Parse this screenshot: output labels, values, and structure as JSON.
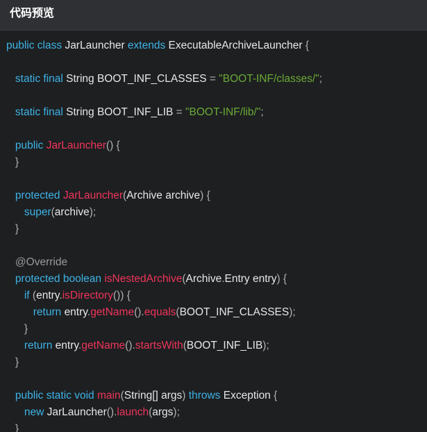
{
  "header": {
    "title": "代码预览"
  },
  "colors": {
    "keyword": "#3fb3e6",
    "string": "#6bab36",
    "function": "#f0355b",
    "plain": "#e8e8e8",
    "background": "#1d1f21",
    "header_bg": "#2f3033"
  },
  "code": {
    "lines": [
      [
        {
          "t": "public class ",
          "c": "kw"
        },
        {
          "t": "JarLauncher ",
          "c": "id"
        },
        {
          "t": "extends ",
          "c": "kw"
        },
        {
          "t": "ExecutableArchiveLauncher ",
          "c": "id"
        },
        {
          "t": "{",
          "c": "op"
        }
      ],
      [],
      [
        {
          "t": "   static final ",
          "c": "kw"
        },
        {
          "t": "String BOOT_INF_CLASSES ",
          "c": "id"
        },
        {
          "t": "= ",
          "c": "op"
        },
        {
          "t": "\"BOOT-INF/classes/\"",
          "c": "str"
        },
        {
          "t": ";",
          "c": "op"
        }
      ],
      [],
      [
        {
          "t": "   static final ",
          "c": "kw"
        },
        {
          "t": "String BOOT_INF_LIB ",
          "c": "id"
        },
        {
          "t": "= ",
          "c": "op"
        },
        {
          "t": "\"BOOT-INF/lib/\"",
          "c": "str"
        },
        {
          "t": ";",
          "c": "op"
        }
      ],
      [],
      [
        {
          "t": "   public ",
          "c": "kw"
        },
        {
          "t": "JarLauncher",
          "c": "fn"
        },
        {
          "t": "() {",
          "c": "op"
        }
      ],
      [
        {
          "t": "   }",
          "c": "op"
        }
      ],
      [],
      [
        {
          "t": "   protected ",
          "c": "kw"
        },
        {
          "t": "JarLauncher",
          "c": "fn"
        },
        {
          "t": "(",
          "c": "op"
        },
        {
          "t": "Archive archive",
          "c": "id"
        },
        {
          "t": ") {",
          "c": "op"
        }
      ],
      [
        {
          "t": "      super",
          "c": "kw"
        },
        {
          "t": "(",
          "c": "op"
        },
        {
          "t": "archive",
          "c": "id"
        },
        {
          "t": ");",
          "c": "op"
        }
      ],
      [
        {
          "t": "   }",
          "c": "op"
        }
      ],
      [],
      [
        {
          "t": "   @Override",
          "c": "ann"
        }
      ],
      [
        {
          "t": "   protected boolean ",
          "c": "kw"
        },
        {
          "t": "isNestedArchive",
          "c": "fn"
        },
        {
          "t": "(",
          "c": "op"
        },
        {
          "t": "Archive",
          "c": "id"
        },
        {
          "t": ".",
          "c": "op"
        },
        {
          "t": "Entry entry",
          "c": "id"
        },
        {
          "t": ") {",
          "c": "op"
        }
      ],
      [
        {
          "t": "      if ",
          "c": "kw"
        },
        {
          "t": "(",
          "c": "op"
        },
        {
          "t": "entry",
          "c": "id"
        },
        {
          "t": ".",
          "c": "op"
        },
        {
          "t": "isDirectory",
          "c": "fn"
        },
        {
          "t": "()) {",
          "c": "op"
        }
      ],
      [
        {
          "t": "         return ",
          "c": "kw"
        },
        {
          "t": "entry",
          "c": "id"
        },
        {
          "t": ".",
          "c": "op"
        },
        {
          "t": "getName",
          "c": "fn"
        },
        {
          "t": "().",
          "c": "op"
        },
        {
          "t": "equals",
          "c": "fn"
        },
        {
          "t": "(",
          "c": "op"
        },
        {
          "t": "BOOT_INF_CLASSES",
          "c": "id"
        },
        {
          "t": ");",
          "c": "op"
        }
      ],
      [
        {
          "t": "      }",
          "c": "op"
        }
      ],
      [
        {
          "t": "      return ",
          "c": "kw"
        },
        {
          "t": "entry",
          "c": "id"
        },
        {
          "t": ".",
          "c": "op"
        },
        {
          "t": "getName",
          "c": "fn"
        },
        {
          "t": "().",
          "c": "op"
        },
        {
          "t": "startsWith",
          "c": "fn"
        },
        {
          "t": "(",
          "c": "op"
        },
        {
          "t": "BOOT_INF_LIB",
          "c": "id"
        },
        {
          "t": ");",
          "c": "op"
        }
      ],
      [
        {
          "t": "   }",
          "c": "op"
        }
      ],
      [],
      [
        {
          "t": "   public static void ",
          "c": "kw"
        },
        {
          "t": "main",
          "c": "fn"
        },
        {
          "t": "(",
          "c": "op"
        },
        {
          "t": "String[] args",
          "c": "id"
        },
        {
          "t": ") ",
          "c": "op"
        },
        {
          "t": "throws ",
          "c": "kw"
        },
        {
          "t": "Exception ",
          "c": "id"
        },
        {
          "t": "{",
          "c": "op"
        }
      ],
      [
        {
          "t": "      new ",
          "c": "kw"
        },
        {
          "t": "JarLauncher",
          "c": "id"
        },
        {
          "t": "().",
          "c": "op"
        },
        {
          "t": "launch",
          "c": "fn"
        },
        {
          "t": "(",
          "c": "op"
        },
        {
          "t": "args",
          "c": "id"
        },
        {
          "t": ");",
          "c": "op"
        }
      ],
      [
        {
          "t": "   }",
          "c": "op"
        }
      ]
    ]
  }
}
